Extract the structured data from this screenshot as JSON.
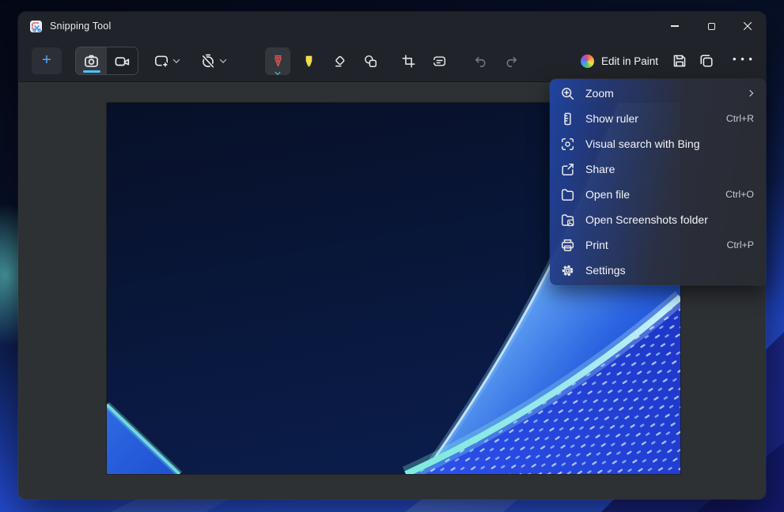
{
  "window": {
    "title": "Snipping Tool"
  },
  "toolbar": {
    "new_button_glyph": "+",
    "edit_in_paint_label": "Edit in Paint",
    "more_glyph": "• • •",
    "capture_mode_selected": "screenshot",
    "annotation_tool_selected": "ballpoint-pen"
  },
  "menu": {
    "items": [
      {
        "icon": "zoom-in-icon",
        "label": "Zoom",
        "shortcut": "",
        "has_submenu": true
      },
      {
        "icon": "ruler-icon",
        "label": "Show ruler",
        "shortcut": "Ctrl+R",
        "has_submenu": false
      },
      {
        "icon": "visual-search-icon",
        "label": "Visual search with Bing",
        "shortcut": "",
        "has_submenu": false
      },
      {
        "icon": "share-icon",
        "label": "Share",
        "shortcut": "",
        "has_submenu": false
      },
      {
        "icon": "open-file-folder-icon",
        "label": "Open file",
        "shortcut": "Ctrl+O",
        "has_submenu": false
      },
      {
        "icon": "screenshots-folder-icon",
        "label": "Open Screenshots folder",
        "shortcut": "",
        "has_submenu": false
      },
      {
        "icon": "printer-icon",
        "label": "Print",
        "shortcut": "Ctrl+P",
        "has_submenu": false
      },
      {
        "icon": "settings-gear-icon",
        "label": "Settings",
        "shortcut": "",
        "has_submenu": false
      }
    ]
  },
  "icons": {
    "titlebar": [
      "snipping-tool-app-icon"
    ],
    "window_controls": [
      "minimize-icon",
      "maximize-icon",
      "close-icon"
    ],
    "toolbar": [
      "new-snip-plus-icon",
      "camera-icon",
      "video-camera-icon",
      "rectangle-mode-icon",
      "delay-timer-off-icon",
      "pen-icon",
      "highlighter-icon",
      "eraser-icon",
      "shapes-icon",
      "crop-icon",
      "text-actions-icon",
      "undo-icon",
      "redo-icon",
      "paint-app-icon",
      "save-icon",
      "copy-icon",
      "more-ellipsis-icon"
    ]
  },
  "colors": {
    "accent_blue": "#4cc2ff",
    "pen_red": "#e05858",
    "highlighter_yellow": "#f1dd4d",
    "titlebar_bg": "#202329",
    "canvas_bg": "#2e3134",
    "menu_blue_tint": "#1f45a3"
  }
}
